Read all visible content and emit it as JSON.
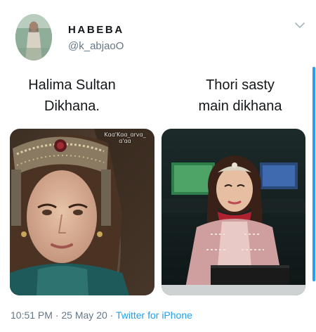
{
  "user": {
    "display_name": "HABEBA",
    "handle": "@k_abjaoO"
  },
  "caption": {
    "left_line1": "Halima Sultan",
    "left_line2": "Dikhana.",
    "right_line1": "Thori sasty",
    "right_line2": "main dikhana"
  },
  "images": {
    "left_watermark": "Kɑɑ'Kɑɑ_ɑrvɑ_ ɑ'ɑɑ",
    "left_alt": "woman wearing ornate jeweled headdress",
    "right_alt": "news anchor wearing headpiece at desk"
  },
  "meta": {
    "time": "10:51 PM",
    "date": "25 May 20",
    "separator": " · ",
    "source": "Twitter for iPhone"
  },
  "icons": {
    "menu": "chevron-down-icon"
  },
  "colors": {
    "accent": "#1da1f2",
    "secondary_text": "#657786"
  }
}
